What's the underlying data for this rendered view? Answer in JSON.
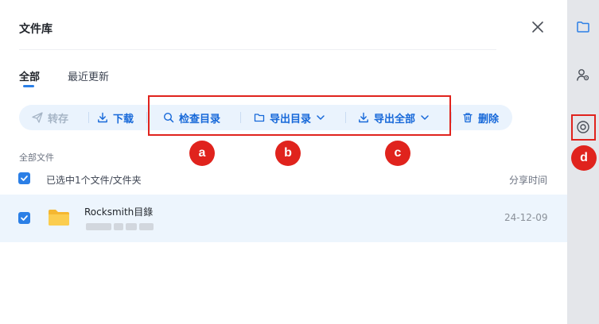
{
  "panel": {
    "title": "文件库",
    "tabs": [
      {
        "label": "全部",
        "active": true
      },
      {
        "label": "最近更新",
        "active": false
      }
    ]
  },
  "toolbar": {
    "save_to": "转存",
    "download": "下载",
    "check_catalog": "检查目录",
    "export_catalog": "导出目录",
    "export_all": "导出全部",
    "delete": "删除"
  },
  "annotations": {
    "a": "a",
    "b": "b",
    "c": "c",
    "d": "d"
  },
  "list": {
    "section_label": "全部文件",
    "selected_text": "已选中1个文件/文件夹",
    "column_share_time": "分享时间",
    "rows": [
      {
        "name": "Rocksmith目錄",
        "date": "24-12-09",
        "checked": true
      }
    ]
  },
  "colors": {
    "accent": "#2b7fe6",
    "toolbar_bg": "#eaf3fd",
    "row_selected_bg": "#edf5fd",
    "annotation_red": "#e0231d",
    "folder_yellow": "#f9c740"
  },
  "icons": {
    "close": "close-icon",
    "save_to": "send-icon",
    "download": "download-icon",
    "check": "search-icon",
    "export_catalog": "folder-icon",
    "export_all": "download-icon",
    "delete": "trash-icon",
    "sidebar": [
      "folder-icon",
      "user-settings-icon",
      "eye-icon"
    ]
  }
}
